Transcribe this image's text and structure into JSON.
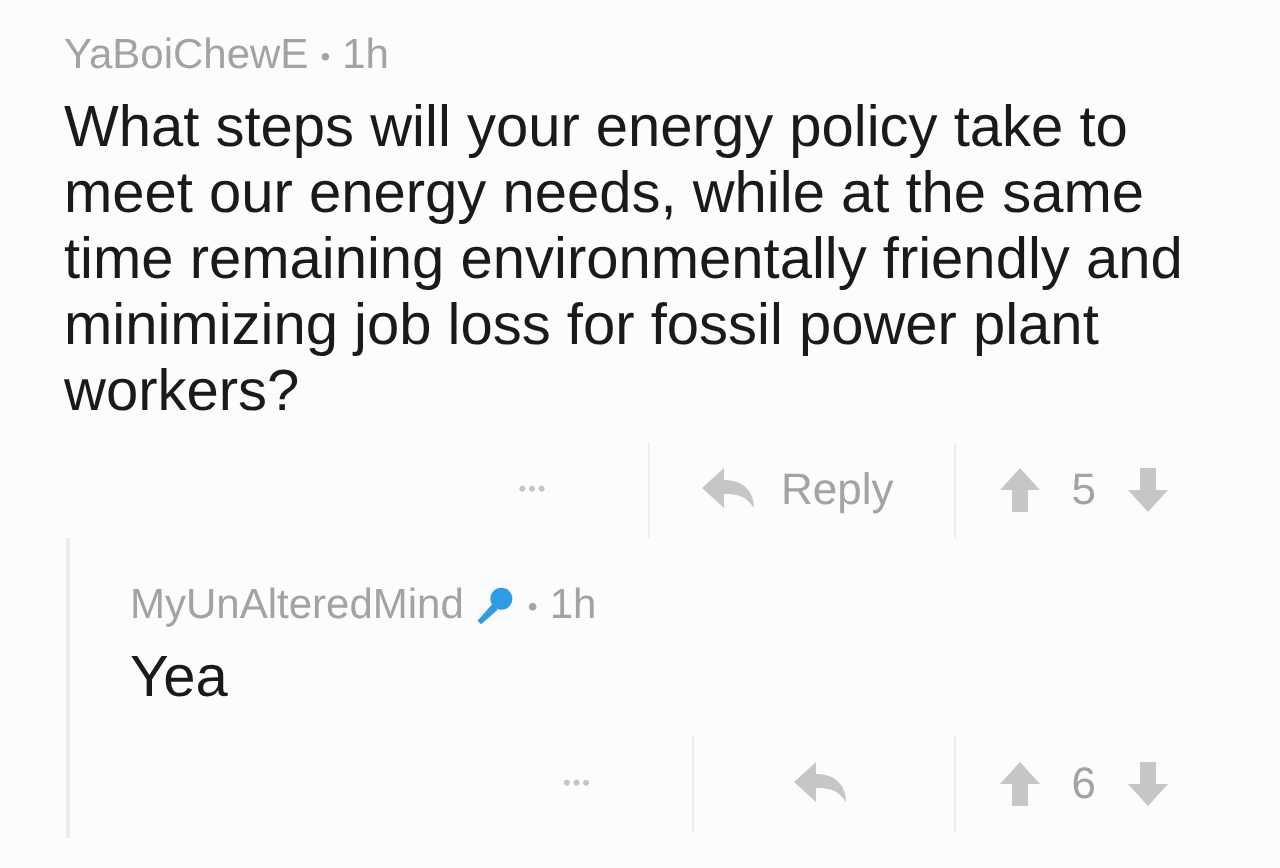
{
  "comments": [
    {
      "author": "YaBoiChewE",
      "separator": "•",
      "time": "1h",
      "mic_badge": false,
      "body": "What steps will your energy policy take to meet our energy needs, while at the same time remaining environmentally friendly and minimizing job loss for fossil power plant workers?",
      "more": "•••",
      "reply_label": "Reply",
      "score": "5",
      "children": [
        {
          "author": "MyUnAlteredMind",
          "separator": "•",
          "time": "1h",
          "mic_badge": true,
          "body": "Yea",
          "more": "•••",
          "score": "6"
        }
      ]
    }
  ]
}
